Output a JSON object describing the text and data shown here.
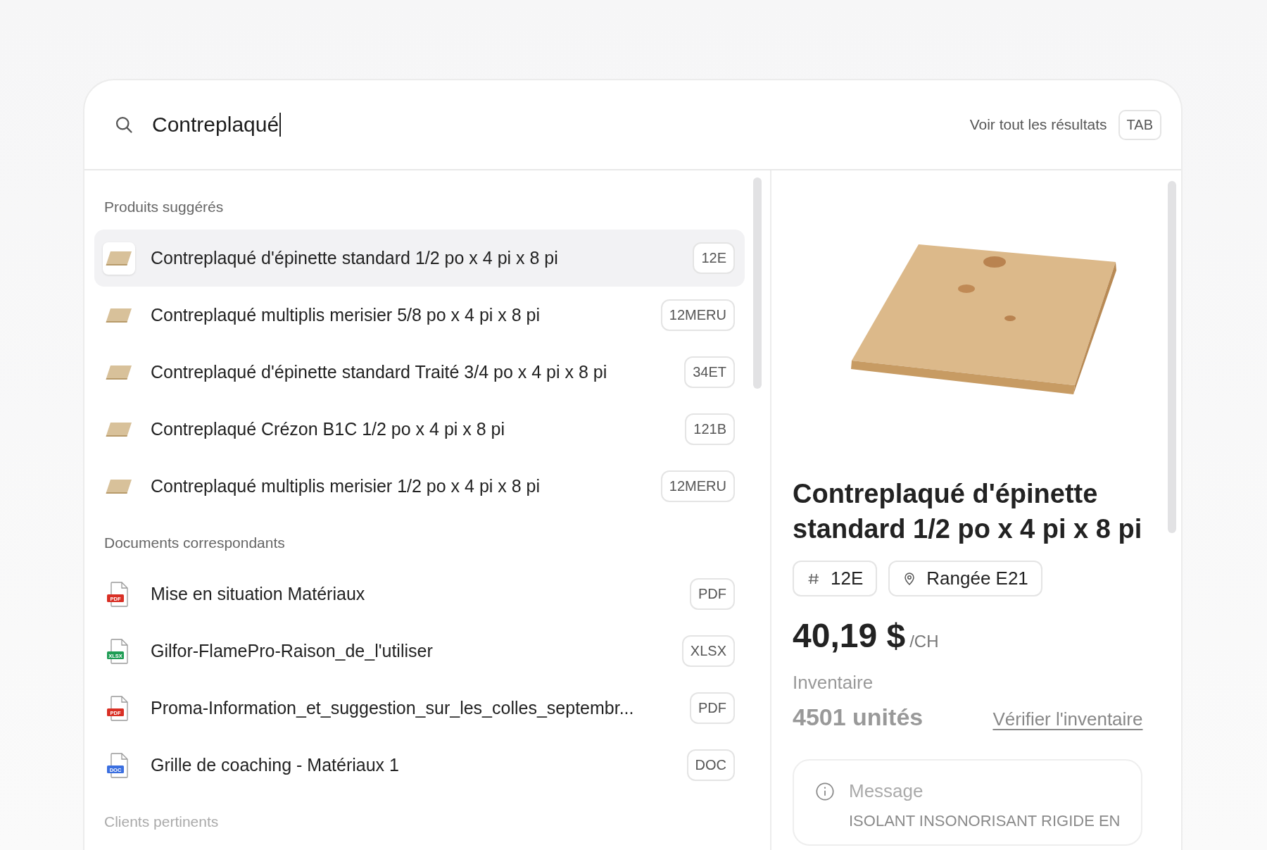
{
  "search": {
    "value": "Contreplaqué",
    "link": "Voir tout les résultats",
    "shortcut": "TAB"
  },
  "sections": [
    {
      "title": "Produits suggérés",
      "kind": "products",
      "items": [
        {
          "name": "Contreplaqué d'épinette standard 1/2 po x 4 pi x 8 pi",
          "code": "12E",
          "selected": true
        },
        {
          "name": "Contreplaqué multiplis merisier 5/8 po x 4 pi x 8 pi",
          "code": "12MERU",
          "selected": false
        },
        {
          "name": "Contreplaqué d'épinette standard Traité 3/4 po x 4 pi x 8 pi",
          "code": "34ET",
          "selected": false
        },
        {
          "name": "Contreplaqué Crézon B1C 1/2 po x 4 pi x 8 pi",
          "code": "121B",
          "selected": false
        },
        {
          "name": "Contreplaqué multiplis merisier 1/2 po x 4 pi x 8 pi",
          "code": "12MERU",
          "selected": false
        }
      ]
    },
    {
      "title": "Documents correspondants",
      "kind": "documents",
      "items": [
        {
          "name": "Mise en situation Matériaux",
          "icon_label": "PDF",
          "color": "#d93025",
          "code": "PDF"
        },
        {
          "name": "Gilfor-FlamePro-Raison_de_l'utiliser",
          "icon_label": "XLSX",
          "color": "#1f9d55",
          "code": "XLSX"
        },
        {
          "name": "Proma-Information_et_suggestion_sur_les_colles_septembr...",
          "icon_label": "PDF",
          "color": "#d93025",
          "code": "PDF"
        },
        {
          "name": "Grille de coaching - Matériaux 1",
          "icon_label": "DOC",
          "color": "#3b6fe0",
          "code": "DOC"
        }
      ]
    },
    {
      "title": "Clients pertinents",
      "kind": "clients"
    }
  ],
  "detail": {
    "title": "Contreplaqué d'épinette standard 1/2 po x 4 pi x 8 pi",
    "code": "12E",
    "location": "Rangée E21",
    "price": "40,19 $",
    "unit": "/CH",
    "inventory_label": "Inventaire",
    "inventory": "4501 unités",
    "inventory_link": "Vérifier l'inventaire",
    "message": {
      "title": "Message",
      "text": "ISOLANT INSONORISANT RIGIDE EN"
    }
  }
}
